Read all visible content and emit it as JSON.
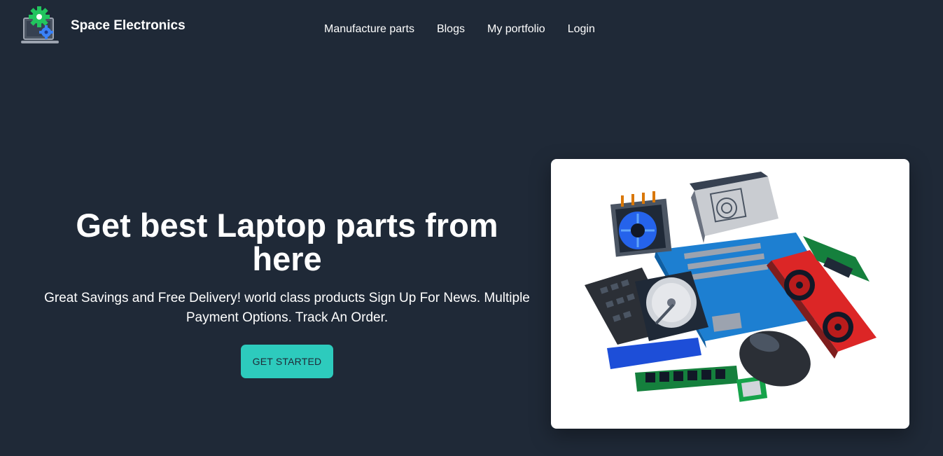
{
  "header": {
    "brand": "Space Electronics",
    "logo_icon": "gear-laptop-icon",
    "nav": [
      "Manufacture parts",
      "Blogs",
      "My portfolio",
      "Login"
    ]
  },
  "hero": {
    "title": "Get best Laptop parts from here",
    "subtitle": "Great Savings and Free Delivery! world class products Sign Up For News. Multiple Payment Options. Track An Order.",
    "cta_label": "GET STARTED"
  },
  "hero_image": {
    "icon": "computer-parts-illustration"
  },
  "colors": {
    "background": "#1f2937",
    "accent": "#2dcbbd",
    "text": "#ffffff"
  }
}
